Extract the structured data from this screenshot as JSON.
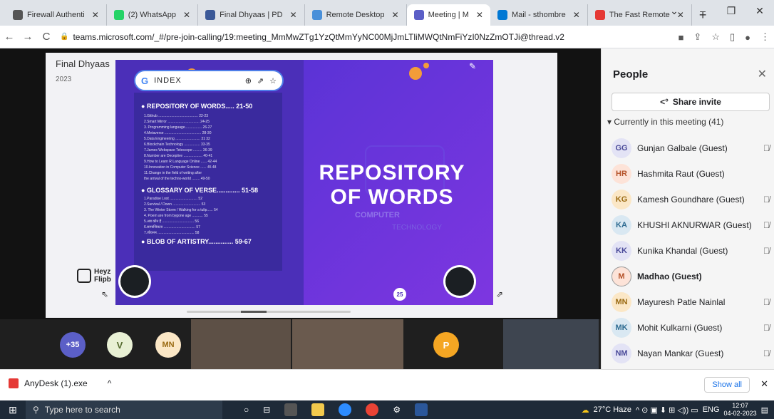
{
  "browser": {
    "tabs": [
      {
        "title": "Firewall Authenti",
        "color": "#555"
      },
      {
        "title": "(2) WhatsApp",
        "color": "#25d366"
      },
      {
        "title": "Final Dhyaas | PD",
        "color": "#3b5998"
      },
      {
        "title": "Remote Desktop",
        "color": "#4a90d9"
      },
      {
        "title": "Meeting | M",
        "color": "#5b5fc7",
        "active": true
      },
      {
        "title": "Mail - sthombre",
        "color": "#0078d4"
      },
      {
        "title": "The Fast Remote",
        "color": "#e53935"
      }
    ],
    "url": "teams.microsoft.com/_#/pre-join-calling/19:meeting_MmMwZTg1YzQtMmYyNC00MjJmLTliMWQtNmFiYzI0NzZmOTJi@thread.v2"
  },
  "doc": {
    "name": "Final Dhyaas",
    "year": "2023"
  },
  "index_bar": {
    "label": "INDEX"
  },
  "toc": {
    "h1": "REPOSITORY OF WORDS..... 21-50",
    "items1": [
      "1.Github ........................................ 22-23",
      "2.Smart Mirror ................................ 24-25",
      "3. Programming language................. 26-27",
      "4.Metaverse ..................................... 28-30",
      "5.Data Engineering ......................... 31 32",
      "6.Blockchain Technology ................ 33-35",
      "7.James Webspace Telescope ......... 36-39",
      "8.Number are Deceptive ................... 40-41",
      "9.How to Learn R Language Online ...... 42-44",
      "10.Innovation in Computer Science ...... 45 48",
      "11.Change in the field of writing after",
      "the arrival of the techno-world ........ 49-50"
    ],
    "h2": "GLOSSARY OF VERSE............. 51-58",
    "items2": [
      "1.Paradise Lost ............................ 52",
      "2.Survival / Down ............................ 53",
      "3. The Winter Storm / Walking for a tulip...... 54",
      "4. Poem are from bygone age ........... 55",
      "5.अब कौन हैं ................................ 56",
      "6.सामाजिकता ................................ 57",
      "7.जीवनम ..................................... 58"
    ],
    "h3": "BLOB OF ARTISTRY.............. 59-67"
  },
  "cover": {
    "line1": "REPOSITORY",
    "line2": "OF WORDS",
    "computer": "COMPUTER",
    "technology": "TECHNOLOGY",
    "page_badge": "25"
  },
  "logo": {
    "text1": "Heyz",
    "text2": "Flipb"
  },
  "strip": {
    "more": "+35",
    "v": "V",
    "mn": "MN",
    "p": "P"
  },
  "people": {
    "title": "People",
    "share": "Share invite",
    "current": "Currently in this meeting (41)",
    "list": [
      {
        "initials": "GG",
        "name": "Gunjan Galbale (Guest)",
        "bg": "#e3e3f5",
        "fg": "#4b4b9a",
        "muted": true
      },
      {
        "initials": "HR",
        "name": "Hashmita Raut (Guest)",
        "bg": "#fde3d8",
        "fg": "#b5532a",
        "muted": false
      },
      {
        "initials": "KG",
        "name": "Kamesh Goundhare (Guest)",
        "bg": "#fbe7c6",
        "fg": "#9a6a12",
        "muted": true
      },
      {
        "initials": "KA",
        "name": "KHUSHI AKNURWAR (Guest)",
        "bg": "#d9e8f2",
        "fg": "#2f6c92",
        "muted": true
      },
      {
        "initials": "KK",
        "name": "Kunika Khandal (Guest)",
        "bg": "#e3e3f5",
        "fg": "#4b4b9a",
        "muted": true
      },
      {
        "initials": "M",
        "name": "Madhao (Guest)",
        "bg": "#fde3d8",
        "fg": "#b5532a",
        "muted": false,
        "bold": true
      },
      {
        "initials": "MN",
        "name": "Mayuresh Patle Nainlal",
        "bg": "#fbe7c6",
        "fg": "#9a6a12",
        "muted": true
      },
      {
        "initials": "MK",
        "name": "Mohit Kulkarni (Guest)",
        "bg": "#d9e8f2",
        "fg": "#2f6c92",
        "muted": true
      },
      {
        "initials": "NM",
        "name": "Nayan Mankar (Guest)",
        "bg": "#e3e3f5",
        "fg": "#4b4b9a",
        "muted": true
      }
    ]
  },
  "download": {
    "file": "AnyDesk (1).exe",
    "show_all": "Show all"
  },
  "taskbar": {
    "search": "Type here to search",
    "weather": "27°C Haze",
    "lang": "ENG",
    "time": "12:07",
    "date": "04-02-2023"
  }
}
